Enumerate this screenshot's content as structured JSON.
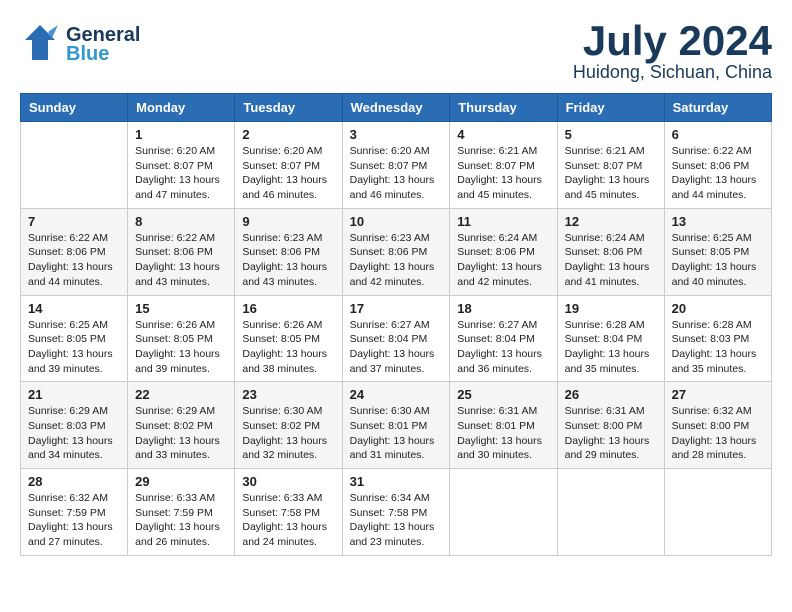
{
  "header": {
    "logo_general": "General",
    "logo_blue": "Blue",
    "month": "July 2024",
    "location": "Huidong, Sichuan, China"
  },
  "columns": [
    "Sunday",
    "Monday",
    "Tuesday",
    "Wednesday",
    "Thursday",
    "Friday",
    "Saturday"
  ],
  "weeks": [
    [
      {
        "day": "",
        "info": ""
      },
      {
        "day": "1",
        "info": "Sunrise: 6:20 AM\nSunset: 8:07 PM\nDaylight: 13 hours\nand 47 minutes."
      },
      {
        "day": "2",
        "info": "Sunrise: 6:20 AM\nSunset: 8:07 PM\nDaylight: 13 hours\nand 46 minutes."
      },
      {
        "day": "3",
        "info": "Sunrise: 6:20 AM\nSunset: 8:07 PM\nDaylight: 13 hours\nand 46 minutes."
      },
      {
        "day": "4",
        "info": "Sunrise: 6:21 AM\nSunset: 8:07 PM\nDaylight: 13 hours\nand 45 minutes."
      },
      {
        "day": "5",
        "info": "Sunrise: 6:21 AM\nSunset: 8:07 PM\nDaylight: 13 hours\nand 45 minutes."
      },
      {
        "day": "6",
        "info": "Sunrise: 6:22 AM\nSunset: 8:06 PM\nDaylight: 13 hours\nand 44 minutes."
      }
    ],
    [
      {
        "day": "7",
        "info": "Sunrise: 6:22 AM\nSunset: 8:06 PM\nDaylight: 13 hours\nand 44 minutes."
      },
      {
        "day": "8",
        "info": "Sunrise: 6:22 AM\nSunset: 8:06 PM\nDaylight: 13 hours\nand 43 minutes."
      },
      {
        "day": "9",
        "info": "Sunrise: 6:23 AM\nSunset: 8:06 PM\nDaylight: 13 hours\nand 43 minutes."
      },
      {
        "day": "10",
        "info": "Sunrise: 6:23 AM\nSunset: 8:06 PM\nDaylight: 13 hours\nand 42 minutes."
      },
      {
        "day": "11",
        "info": "Sunrise: 6:24 AM\nSunset: 8:06 PM\nDaylight: 13 hours\nand 42 minutes."
      },
      {
        "day": "12",
        "info": "Sunrise: 6:24 AM\nSunset: 8:06 PM\nDaylight: 13 hours\nand 41 minutes."
      },
      {
        "day": "13",
        "info": "Sunrise: 6:25 AM\nSunset: 8:05 PM\nDaylight: 13 hours\nand 40 minutes."
      }
    ],
    [
      {
        "day": "14",
        "info": "Sunrise: 6:25 AM\nSunset: 8:05 PM\nDaylight: 13 hours\nand 39 minutes."
      },
      {
        "day": "15",
        "info": "Sunrise: 6:26 AM\nSunset: 8:05 PM\nDaylight: 13 hours\nand 39 minutes."
      },
      {
        "day": "16",
        "info": "Sunrise: 6:26 AM\nSunset: 8:05 PM\nDaylight: 13 hours\nand 38 minutes."
      },
      {
        "day": "17",
        "info": "Sunrise: 6:27 AM\nSunset: 8:04 PM\nDaylight: 13 hours\nand 37 minutes."
      },
      {
        "day": "18",
        "info": "Sunrise: 6:27 AM\nSunset: 8:04 PM\nDaylight: 13 hours\nand 36 minutes."
      },
      {
        "day": "19",
        "info": "Sunrise: 6:28 AM\nSunset: 8:04 PM\nDaylight: 13 hours\nand 35 minutes."
      },
      {
        "day": "20",
        "info": "Sunrise: 6:28 AM\nSunset: 8:03 PM\nDaylight: 13 hours\nand 35 minutes."
      }
    ],
    [
      {
        "day": "21",
        "info": "Sunrise: 6:29 AM\nSunset: 8:03 PM\nDaylight: 13 hours\nand 34 minutes."
      },
      {
        "day": "22",
        "info": "Sunrise: 6:29 AM\nSunset: 8:02 PM\nDaylight: 13 hours\nand 33 minutes."
      },
      {
        "day": "23",
        "info": "Sunrise: 6:30 AM\nSunset: 8:02 PM\nDaylight: 13 hours\nand 32 minutes."
      },
      {
        "day": "24",
        "info": "Sunrise: 6:30 AM\nSunset: 8:01 PM\nDaylight: 13 hours\nand 31 minutes."
      },
      {
        "day": "25",
        "info": "Sunrise: 6:31 AM\nSunset: 8:01 PM\nDaylight: 13 hours\nand 30 minutes."
      },
      {
        "day": "26",
        "info": "Sunrise: 6:31 AM\nSunset: 8:00 PM\nDaylight: 13 hours\nand 29 minutes."
      },
      {
        "day": "27",
        "info": "Sunrise: 6:32 AM\nSunset: 8:00 PM\nDaylight: 13 hours\nand 28 minutes."
      }
    ],
    [
      {
        "day": "28",
        "info": "Sunrise: 6:32 AM\nSunset: 7:59 PM\nDaylight: 13 hours\nand 27 minutes."
      },
      {
        "day": "29",
        "info": "Sunrise: 6:33 AM\nSunset: 7:59 PM\nDaylight: 13 hours\nand 26 minutes."
      },
      {
        "day": "30",
        "info": "Sunrise: 6:33 AM\nSunset: 7:58 PM\nDaylight: 13 hours\nand 24 minutes."
      },
      {
        "day": "31",
        "info": "Sunrise: 6:34 AM\nSunset: 7:58 PM\nDaylight: 13 hours\nand 23 minutes."
      },
      {
        "day": "",
        "info": ""
      },
      {
        "day": "",
        "info": ""
      },
      {
        "day": "",
        "info": ""
      }
    ]
  ]
}
